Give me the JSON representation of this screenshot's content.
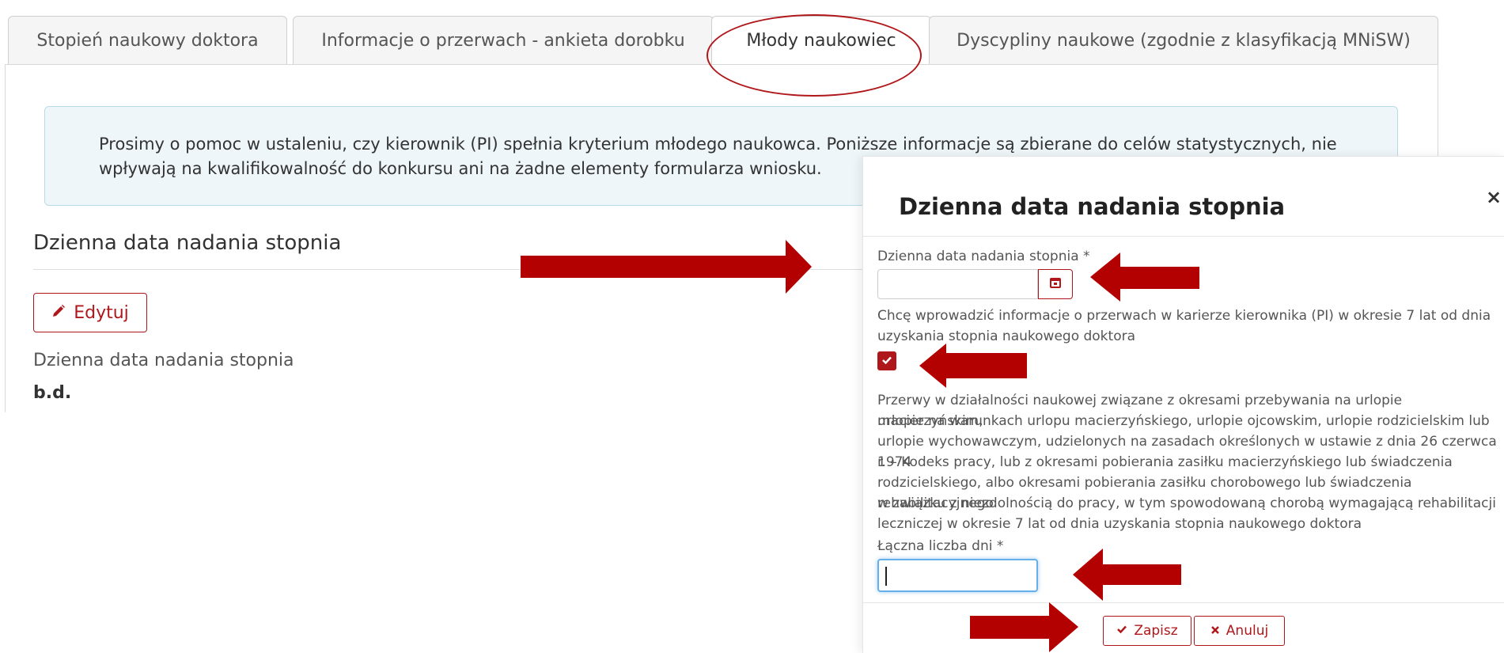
{
  "tabs": [
    {
      "label": "Stopień naukowy doktora"
    },
    {
      "label": "Informacje o przerwach - ankieta dorobku"
    },
    {
      "label": "Młody naukowiec"
    },
    {
      "label": "Dyscypliny naukowe (zgodnie z klasyfikacją MNiSW)"
    }
  ],
  "info": {
    "line1": "Prosimy o pomoc w ustaleniu, czy kierownik (PI) spełnia kryterium młodego naukowca. Poniższe informacje są zbierane do celów statystycznych, nie",
    "line2": "wpływają na kwalifikowalność do konkursu ani na żadne elementy formularza wniosku."
  },
  "section": {
    "title": "Dzienna data nadania stopnia",
    "edit_label": "Edytuj",
    "field_label": "Dzienna data nadania stopnia",
    "field_value": "b.d."
  },
  "modal": {
    "title": "Dzienna data nadania stopnia",
    "close": "×",
    "date_label": "Dzienna data nadania stopnia *",
    "date_value": "",
    "checkbox_label_1": "Chcę wprowadzić informacje o przerwach w karierze kierownika (PI) w okresie 7 lat od dnia",
    "checkbox_label_2": "uzyskania stopnia naukowego doktora",
    "checkbox_checked": true,
    "desc_lines": [
      "Przerwy w działalności naukowej związane z okresami przebywania na urlopie macierzyńskim,",
      "urlopie na warunkach urlopu macierzyńskiego, urlopie ojcowskim, urlopie rodzicielskim lub",
      "urlopie wychowawczym, udzielonych na zasadach określonych w ustawie z dnia 26 czerwca 1974",
      "r. – Kodeks pracy, lub z okresami pobierania zasiłku macierzyńskiego lub świadczenia",
      "rodzicielskiego, albo okresami pobierania zasiłku chorobowego lub świadczenia rehabilitacyjnego",
      "w związku z niezdolnością do pracy, w tym spowodowaną chorobą wymagającą rehabilitacji",
      "leczniczej w okresie 7 lat od dnia uzyskania stopnia naukowego doktora"
    ],
    "days_label": "Łączna liczba dni *",
    "days_value": "",
    "save_label": "Zapisz",
    "cancel_label": "Anuluj"
  },
  "colors": {
    "accent": "#b0171a",
    "info_bg": "#eef6fa",
    "arrow": "#b30000"
  },
  "icons": {
    "edit": "pencil-icon",
    "calendar": "calendar-icon",
    "check": "check-icon",
    "close": "close-icon",
    "cancel": "x-icon"
  }
}
